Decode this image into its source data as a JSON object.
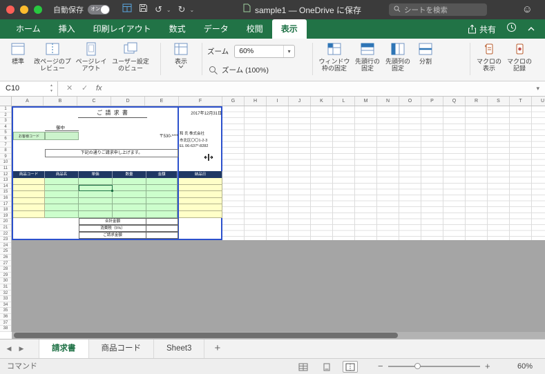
{
  "zoom_value": "60%",
  "titlebar": {
    "autosave_label": "自動保存",
    "autosave_state": "オン",
    "title": "sample1 — OneDrive に保存",
    "search_placeholder": "シートを検索"
  },
  "tabs": [
    "ホーム",
    "挿入",
    "印刷レイアウト",
    "数式",
    "データ",
    "校閲",
    "表示"
  ],
  "tabbar_right": {
    "share": "共有"
  },
  "ribbon": {
    "normal": "標準",
    "page_break_preview": "改ページのプレビュー",
    "page_layout": "ページレイアウト",
    "custom_views": "ユーザー設定のビュー",
    "show": "表示",
    "zoom_label": "ズーム",
    "zoom_100": "ズーム (100%)",
    "freeze_panes": "ウィンドウ枠の固定",
    "freeze_row": "先頭行の固定",
    "freeze_col": "先頭列の固定",
    "split": "分割",
    "macro_view": "マクロの表示",
    "macro_record": "マクロの記録"
  },
  "formula_bar": {
    "name_box": "C10",
    "fx_label": "fx"
  },
  "grid": {
    "columns": [
      "A",
      "B",
      "C",
      "D",
      "E",
      "F",
      "G",
      "H",
      "I",
      "J",
      "K",
      "L",
      "M",
      "N",
      "O",
      "P",
      "Q",
      "R",
      "S",
      "T",
      "U"
    ],
    "rows": [
      1,
      2,
      3,
      4,
      5,
      6,
      7,
      8,
      9,
      10,
      11,
      12,
      13,
      14,
      15,
      16,
      17,
      18,
      19,
      20,
      21,
      22,
      23,
      24,
      25,
      26,
      27,
      28,
      29,
      30,
      31,
      32,
      33,
      34,
      35,
      36,
      37,
      38
    ]
  },
  "invoice": {
    "title": "ご 請 求 書",
    "date": "2017年12月31日",
    "recipient_suffix": "御中",
    "customer_code_label": "お客様コード",
    "postal": "〒530-****",
    "company": "和 氏 株式会社",
    "address": "市北区〇〇1-2-3",
    "tel": "EL  06-637*-8282",
    "note": "下記の通りご請求申し上げます。",
    "table_headers": [
      "商品コード",
      "商品名",
      "単価",
      "数量",
      "金額",
      "納品日"
    ],
    "totals": [
      "合計金額",
      "消費税（5%）",
      "ご請求金額"
    ]
  },
  "sheets": {
    "tabs": [
      "請求書",
      "商品コード",
      "Sheet3"
    ],
    "active": "請求書"
  },
  "status": {
    "mode": "コマンド"
  }
}
